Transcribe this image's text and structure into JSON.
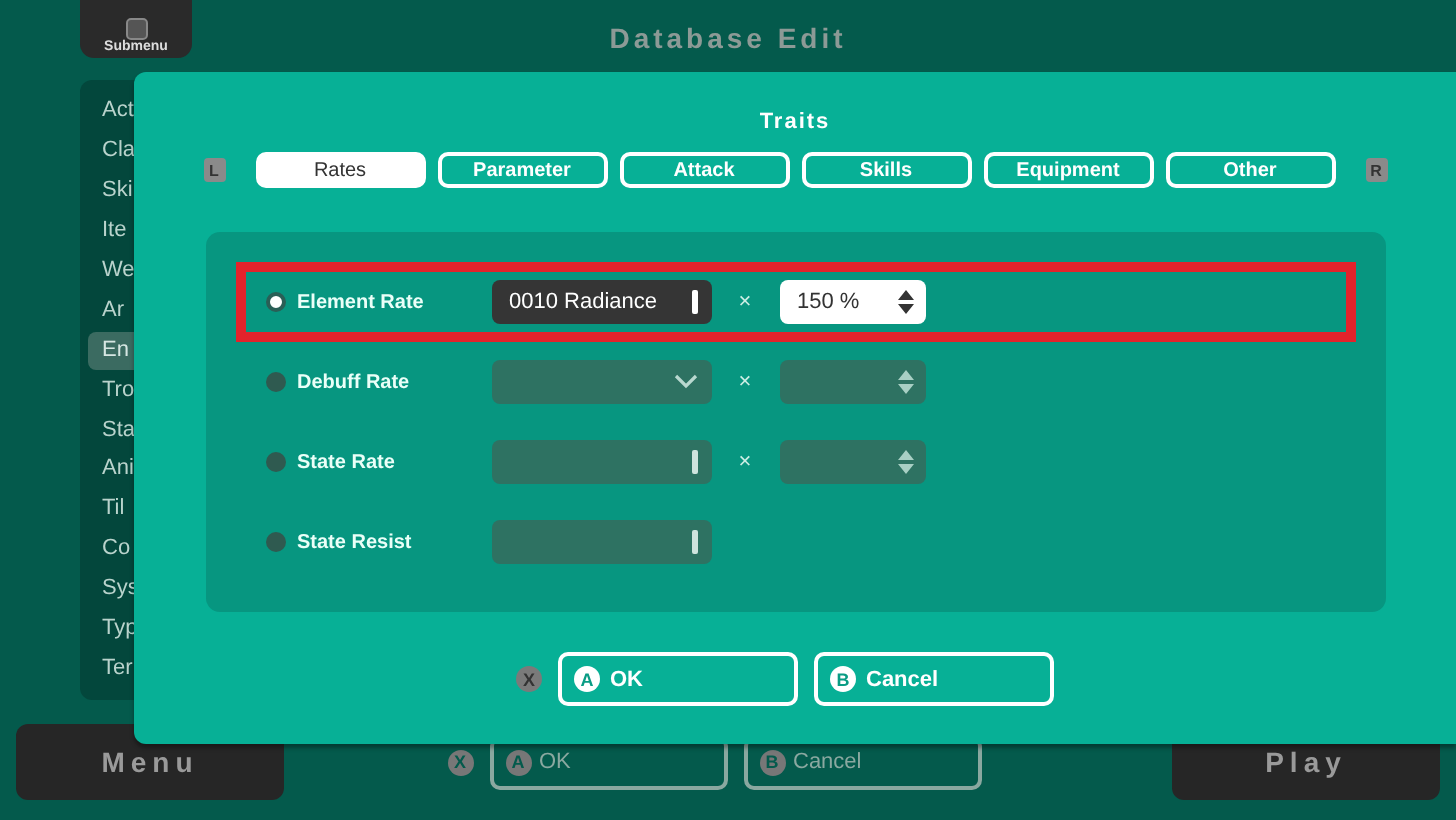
{
  "submenu_button": {
    "label": "Submenu"
  },
  "title": "Database Edit",
  "sidebar": {
    "items": [
      {
        "label": "Act",
        "selected": false
      },
      {
        "label": "Cla",
        "selected": false
      },
      {
        "label": "Ski",
        "selected": false
      },
      {
        "label": "Ite",
        "selected": false
      },
      {
        "label": "We",
        "selected": false
      },
      {
        "label": "Ar",
        "selected": false
      },
      {
        "label": "En",
        "selected": true
      },
      {
        "label": "Tro",
        "selected": false
      },
      {
        "label": "Sta",
        "selected": false
      },
      {
        "label": "Ani",
        "selected": false
      },
      {
        "label": "Til",
        "selected": false
      },
      {
        "label": "Co",
        "selected": false
      },
      {
        "label": "Sys",
        "selected": false
      },
      {
        "label": "Typ",
        "selected": false
      },
      {
        "label": "Ter",
        "selected": false
      }
    ]
  },
  "dialog": {
    "title": "Traits",
    "prev_key": "L",
    "next_key": "R",
    "tabs": [
      {
        "label": "Rates",
        "selected": true
      },
      {
        "label": "Parameter",
        "selected": false
      },
      {
        "label": "Attack",
        "selected": false
      },
      {
        "label": "Skills",
        "selected": false
      },
      {
        "label": "Equipment",
        "selected": false
      },
      {
        "label": "Other",
        "selected": false
      }
    ],
    "rows": [
      {
        "label": "Element Rate",
        "selected": true,
        "highlighted": true,
        "field": {
          "kind": "picker",
          "value": "0010 Radiance"
        },
        "times": "×",
        "multiplier": {
          "value": "150 %"
        }
      },
      {
        "label": "Debuff Rate",
        "selected": false,
        "highlighted": false,
        "field": {
          "kind": "dropdown"
        },
        "times": "×",
        "multiplier": {}
      },
      {
        "label": "State Rate",
        "selected": false,
        "highlighted": false,
        "field": {
          "kind": "picker"
        },
        "times": "×",
        "multiplier": {}
      },
      {
        "label": "State Resist",
        "selected": false,
        "highlighted": false,
        "field": {
          "kind": "picker"
        }
      }
    ],
    "close_key": "X",
    "buttons": [
      {
        "key": "A",
        "label": "OK"
      },
      {
        "key": "B",
        "label": "Cancel"
      }
    ]
  },
  "footer": {
    "menu_button": {
      "label": "Menu"
    },
    "close_key": "X",
    "buttons": [
      {
        "key": "A",
        "label": "OK"
      },
      {
        "key": "B",
        "label": "Cancel"
      }
    ],
    "play_button": {
      "label": "Play"
    }
  }
}
